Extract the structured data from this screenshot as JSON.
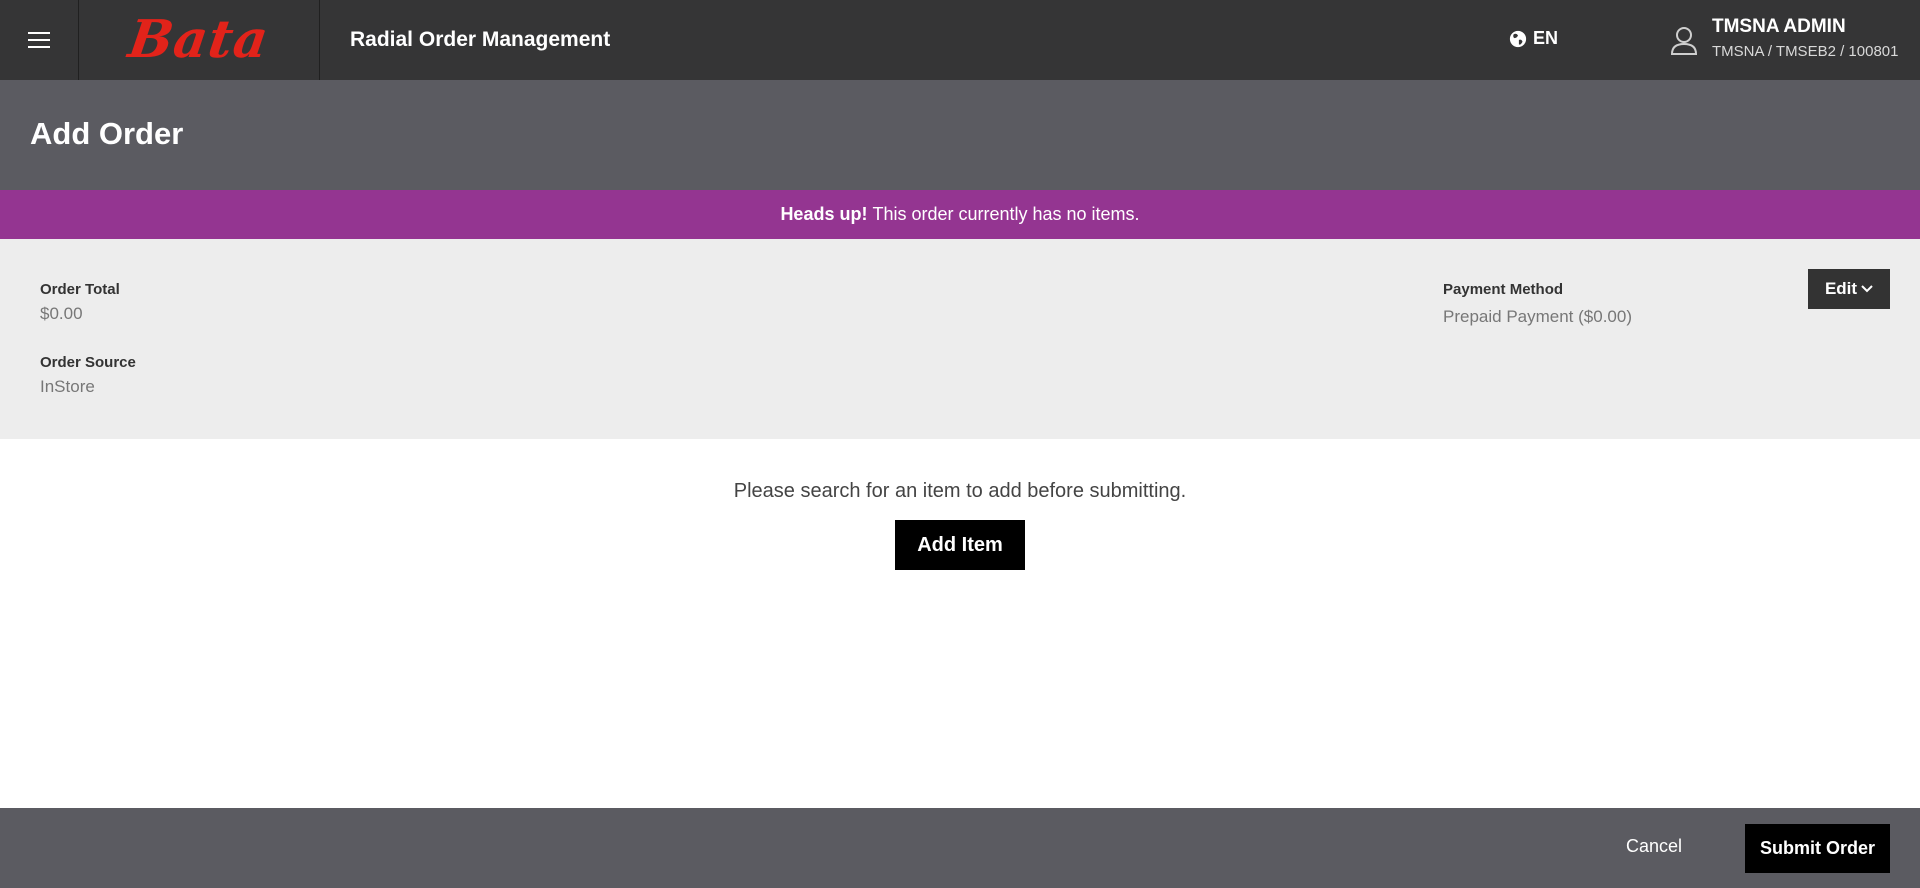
{
  "header": {
    "brand": "Bata",
    "app_title": "Radial Order Management",
    "language": "EN",
    "user_name": "TMSNA ADMIN",
    "user_context": "TMSNA / TMSEB2 / 100801"
  },
  "page": {
    "title": "Add Order"
  },
  "banner": {
    "strong": "Heads up!",
    "text": "This order currently has no items."
  },
  "summary": {
    "order_total_label": "Order Total",
    "order_total_value": "$0.00",
    "order_source_label": "Order Source",
    "order_source_value": "InStore",
    "payment_method_label": "Payment Method",
    "payment_method_value": "Prepaid Payment ($0.00)",
    "edit_label": "Edit"
  },
  "content": {
    "empty_message": "Please search for an item to add before submitting.",
    "add_item_label": "Add Item"
  },
  "footer": {
    "cancel_label": "Cancel",
    "submit_label": "Submit Order"
  },
  "colors": {
    "topbar": "#353536",
    "header": "#5b5b61",
    "banner": "#943591",
    "brand_red": "#e2231a",
    "summary_bg": "#ededed"
  }
}
